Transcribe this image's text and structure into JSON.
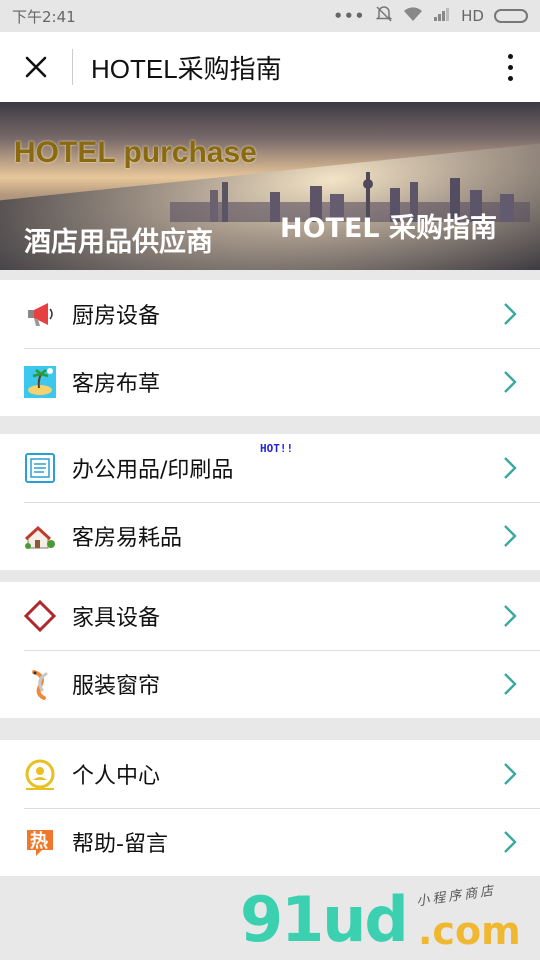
{
  "status_bar": {
    "time": "下午2:41",
    "network": "HD",
    "dots": "•••"
  },
  "header": {
    "title": "HOTEL采购指南"
  },
  "banner": {
    "en_title": "HOTEL purchase",
    "cn_left": "酒店用品供应商",
    "cn_right": "HOTEL 采购指南"
  },
  "menu_groups": [
    {
      "items": [
        {
          "label": "厨房设备",
          "icon": "megaphone-icon"
        },
        {
          "label": "客房布草",
          "icon": "beach-icon"
        }
      ]
    },
    {
      "items": [
        {
          "label": "办公用品/印刷品",
          "icon": "document-icon",
          "badge": "HOT!!"
        },
        {
          "label": "客房易耗品",
          "icon": "house-icon"
        }
      ]
    },
    {
      "items": [
        {
          "label": "家具设备",
          "icon": "diamond-icon"
        },
        {
          "label": "服装窗帘",
          "icon": "koi-icon"
        }
      ]
    },
    {
      "items": [
        {
          "label": "个人中心",
          "icon": "user-icon"
        },
        {
          "label": "帮助-留言",
          "icon": "hot-tag-icon",
          "icon_text": "热"
        }
      ]
    }
  ],
  "watermark": {
    "main": "91ud",
    "domain": ".com",
    "tagline": "小程序商店"
  },
  "colors": {
    "accent": "#3aa9a0",
    "hot_badge": "#2222dd"
  }
}
